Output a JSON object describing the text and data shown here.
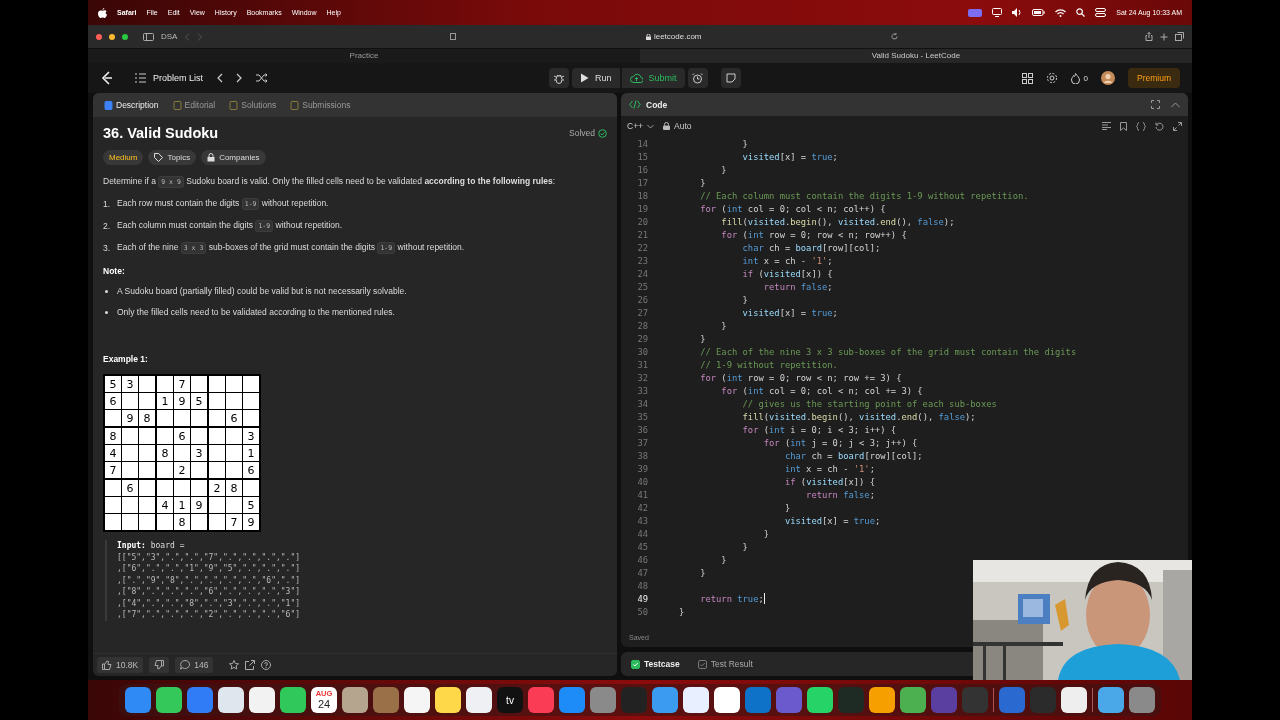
{
  "menubar": {
    "app": "Safari",
    "items": [
      "File",
      "Edit",
      "View",
      "History",
      "Bookmarks",
      "Window",
      "Help"
    ],
    "clock": "Sat 24 Aug 10:33 AM"
  },
  "browser": {
    "profile": "DSA",
    "url": "leetcode.com",
    "tabs": [
      {
        "title": "Practice",
        "selected": false
      },
      {
        "title": "Valid Sudoku - LeetCode",
        "selected": true
      }
    ]
  },
  "nav": {
    "problem_list": "Problem List",
    "run": "Run",
    "submit": "Submit",
    "streak": "0",
    "premium": "Premium"
  },
  "description": {
    "tabs": [
      {
        "label": "Description",
        "selected": true
      },
      {
        "label": "Editorial",
        "selected": false
      },
      {
        "label": "Solutions",
        "selected": false
      },
      {
        "label": "Submissions",
        "selected": false
      }
    ],
    "title": "36. Valid Sudoku",
    "status": "Solved",
    "difficulty": "Medium",
    "tags": [
      "Topics",
      "Companies"
    ],
    "intro": [
      {
        "text": "Determine if a "
      },
      {
        "code": "9 x 9"
      },
      {
        "text": " Sudoku board is valid. Only the filled cells need to be validated **according to the following rules**:"
      }
    ],
    "rules": [
      {
        "num": "1.",
        "parts": [
          {
            "text": "Each row must contain the digits "
          },
          {
            "code": "1-9"
          },
          {
            "text": " without repetition."
          }
        ]
      },
      {
        "num": "2.",
        "parts": [
          {
            "text": "Each column must contain the digits "
          },
          {
            "code": "1-9"
          },
          {
            "text": " without repetition."
          }
        ]
      },
      {
        "num": "3.",
        "parts": [
          {
            "text": "Each of the nine "
          },
          {
            "code": "3 x 3"
          },
          {
            "text": " sub-boxes of the grid must contain the digits "
          },
          {
            "code": "1-9"
          },
          {
            "text": " without repetition."
          }
        ]
      }
    ],
    "note_heading": "Note:",
    "notes": [
      "A Sudoku board (partially filled) could be valid but is not necessarily solvable.",
      "Only the filled cells need to be validated according to the mentioned rules."
    ],
    "example_heading": "Example 1:",
    "board": [
      [
        {
          "kind": "digit",
          "digit": "5"
        },
        {
          "kind": "digit",
          "digit": "3"
        },
        {
          "kind": "empty"
        },
        {
          "kind": "empty"
        },
        {
          "kind": "digit",
          "digit": "7"
        },
        {
          "kind": "empty"
        },
        {
          "kind": "empty"
        },
        {
          "kind": "empty"
        },
        {
          "kind": "empty"
        }
      ],
      [
        {
          "kind": "digit",
          "digit": "6"
        },
        {
          "kind": "empty"
        },
        {
          "kind": "empty"
        },
        {
          "kind": "digit",
          "digit": "1"
        },
        {
          "kind": "digit",
          "digit": "9"
        },
        {
          "kind": "digit",
          "digit": "5"
        },
        {
          "kind": "empty"
        },
        {
          "kind": "empty"
        },
        {
          "kind": "empty"
        }
      ],
      [
        {
          "kind": "empty"
        },
        {
          "kind": "digit",
          "digit": "9"
        },
        {
          "kind": "digit",
          "digit": "8"
        },
        {
          "kind": "empty"
        },
        {
          "kind": "empty"
        },
        {
          "kind": "empty"
        },
        {
          "kind": "empty"
        },
        {
          "kind": "digit",
          "digit": "6"
        },
        {
          "kind": "empty"
        }
      ],
      [
        {
          "kind": "digit",
          "digit": "8"
        },
        {
          "kind": "empty"
        },
        {
          "kind": "empty"
        },
        {
          "kind": "empty"
        },
        {
          "kind": "digit",
          "digit": "6"
        },
        {
          "kind": "empty"
        },
        {
          "kind": "empty"
        },
        {
          "kind": "empty"
        },
        {
          "kind": "digit",
          "digit": "3"
        }
      ],
      [
        {
          "kind": "digit",
          "digit": "4"
        },
        {
          "kind": "empty"
        },
        {
          "kind": "empty"
        },
        {
          "kind": "digit",
          "digit": "8"
        },
        {
          "kind": "empty"
        },
        {
          "kind": "digit",
          "digit": "3"
        },
        {
          "kind": "empty"
        },
        {
          "kind": "empty"
        },
        {
          "kind": "digit",
          "digit": "1"
        }
      ],
      [
        {
          "kind": "digit",
          "digit": "7"
        },
        {
          "kind": "empty"
        },
        {
          "kind": "empty"
        },
        {
          "kind": "empty"
        },
        {
          "kind": "digit",
          "digit": "2"
        },
        {
          "kind": "empty"
        },
        {
          "kind": "empty"
        },
        {
          "kind": "empty"
        },
        {
          "kind": "digit",
          "digit": "6"
        }
      ],
      [
        {
          "kind": "empty"
        },
        {
          "kind": "digit",
          "digit": "6"
        },
        {
          "kind": "empty"
        },
        {
          "kind": "empty"
        },
        {
          "kind": "empty"
        },
        {
          "kind": "empty"
        },
        {
          "kind": "digit",
          "digit": "2"
        },
        {
          "kind": "digit",
          "digit": "8"
        },
        {
          "kind": "empty"
        }
      ],
      [
        {
          "kind": "empty"
        },
        {
          "kind": "empty"
        },
        {
          "kind": "empty"
        },
        {
          "kind": "digit",
          "digit": "4"
        },
        {
          "kind": "digit",
          "digit": "1"
        },
        {
          "kind": "digit",
          "digit": "9"
        },
        {
          "kind": "empty"
        },
        {
          "kind": "empty"
        },
        {
          "kind": "digit",
          "digit": "5"
        }
      ],
      [
        {
          "kind": "empty"
        },
        {
          "kind": "empty"
        },
        {
          "kind": "empty"
        },
        {
          "kind": "empty"
        },
        {
          "kind": "digit",
          "digit": "8"
        },
        {
          "kind": "empty"
        },
        {
          "kind": "empty"
        },
        {
          "kind": "digit",
          "digit": "7"
        },
        {
          "kind": "digit",
          "digit": "9"
        }
      ]
    ],
    "input_label": "Input:",
    "input_intro": "board =",
    "input_lines": [
      "[[\"5\",\"3\",\".\",\".\",\"7\",\".\",\".\",\".\",\".\"]",
      ",[\"6\",\".\",\".\",\"1\",\"9\",\"5\",\".\",\".\",\".\"]",
      ",[\".\",\"9\",\"8\",\".\",\".\",\".\",\".\",\"6\",\".\"]",
      ",[\"8\",\".\",\".\",\".\",\"6\",\".\",\".\",\".\",\"3\"]",
      ",[\"4\",\".\",\".\",\"8\",\".\",\"3\",\".\",\".\",\"1\"]",
      ",[\"7\",\".\",\".\",\".\",\"2\",\".\",\".\",\".\",\"6\"]"
    ],
    "likes": "10.8K",
    "comments": "146"
  },
  "code": {
    "title": "Code",
    "language": "C++",
    "mode": "Auto",
    "status": "Saved",
    "lines": [
      {
        "n": "14",
        "current": false,
        "s": [
          {
            "kind": "plain",
            "text": "            }"
          }
        ]
      },
      {
        "n": "15",
        "current": false,
        "s": [
          {
            "kind": "variable",
            "text": "            visited"
          },
          {
            "kind": "plain",
            "text": "[x] = "
          },
          {
            "kind": "type",
            "text": "true"
          },
          {
            "kind": "plain",
            "text": ";"
          }
        ]
      },
      {
        "n": "16",
        "current": false,
        "s": [
          {
            "kind": "plain",
            "text": "        }"
          }
        ]
      },
      {
        "n": "17",
        "current": false,
        "s": [
          {
            "kind": "plain",
            "text": "    }"
          }
        ]
      },
      {
        "n": "18",
        "current": false,
        "s": [
          {
            "kind": "comment",
            "text": "    // Each column must contain the digits 1-9 without repetition."
          }
        ]
      },
      {
        "n": "19",
        "current": false,
        "s": [
          {
            "kind": "keyword",
            "text": "    for"
          },
          {
            "kind": "plain",
            "text": " ("
          },
          {
            "kind": "type",
            "text": "int"
          },
          {
            "kind": "plain",
            "text": " col = 0; col < n; col++) {"
          }
        ]
      },
      {
        "n": "20",
        "current": false,
        "s": [
          {
            "kind": "function",
            "text": "        fill"
          },
          {
            "kind": "plain",
            "text": "("
          },
          {
            "kind": "variable",
            "text": "visited"
          },
          {
            "kind": "plain",
            "text": "."
          },
          {
            "kind": "function",
            "text": "begin"
          },
          {
            "kind": "plain",
            "text": "(), "
          },
          {
            "kind": "variable",
            "text": "visited"
          },
          {
            "kind": "plain",
            "text": "."
          },
          {
            "kind": "function",
            "text": "end"
          },
          {
            "kind": "plain",
            "text": "(), "
          },
          {
            "kind": "type",
            "text": "false"
          },
          {
            "kind": "plain",
            "text": ");"
          }
        ]
      },
      {
        "n": "21",
        "current": false,
        "s": [
          {
            "kind": "keyword",
            "text": "        for"
          },
          {
            "kind": "plain",
            "text": " ("
          },
          {
            "kind": "type",
            "text": "int"
          },
          {
            "kind": "plain",
            "text": " row = 0; row < n; row++) {"
          }
        ]
      },
      {
        "n": "22",
        "current": false,
        "s": [
          {
            "kind": "type",
            "text": "            char"
          },
          {
            "kind": "plain",
            "text": " ch = "
          },
          {
            "kind": "variable",
            "text": "board"
          },
          {
            "kind": "plain",
            "text": "[row][col];"
          }
        ]
      },
      {
        "n": "23",
        "current": false,
        "s": [
          {
            "kind": "type",
            "text": "            int"
          },
          {
            "kind": "plain",
            "text": " x = ch - "
          },
          {
            "kind": "string",
            "text": "'1'"
          },
          {
            "kind": "plain",
            "text": ";"
          }
        ]
      },
      {
        "n": "24",
        "current": false,
        "s": [
          {
            "kind": "keyword",
            "text": "            if"
          },
          {
            "kind": "plain",
            "text": " ("
          },
          {
            "kind": "variable",
            "text": "visited"
          },
          {
            "kind": "plain",
            "text": "[x]) {"
          }
        ]
      },
      {
        "n": "25",
        "current": false,
        "s": [
          {
            "kind": "keyword",
            "text": "                return "
          },
          {
            "kind": "type",
            "text": "false"
          },
          {
            "kind": "plain",
            "text": ";"
          }
        ]
      },
      {
        "n": "26",
        "current": false,
        "s": [
          {
            "kind": "plain",
            "text": "            }"
          }
        ]
      },
      {
        "n": "27",
        "current": false,
        "s": [
          {
            "kind": "variable",
            "text": "            visited"
          },
          {
            "kind": "plain",
            "text": "[x] = "
          },
          {
            "kind": "type",
            "text": "true"
          },
          {
            "kind": "plain",
            "text": ";"
          }
        ]
      },
      {
        "n": "28",
        "current": false,
        "s": [
          {
            "kind": "plain",
            "text": "        }"
          }
        ]
      },
      {
        "n": "29",
        "current": false,
        "s": [
          {
            "kind": "plain",
            "text": "    }"
          }
        ]
      },
      {
        "n": "30",
        "current": false,
        "s": [
          {
            "kind": "comment",
            "text": "    // Each of the nine 3 x 3 sub-boxes of the grid must contain the digits"
          }
        ]
      },
      {
        "n": "31",
        "current": false,
        "s": [
          {
            "kind": "comment",
            "text": "    // 1-9 without repetition."
          }
        ]
      },
      {
        "n": "32",
        "current": false,
        "s": [
          {
            "kind": "keyword",
            "text": "    for"
          },
          {
            "kind": "plain",
            "text": " ("
          },
          {
            "kind": "type",
            "text": "int"
          },
          {
            "kind": "plain",
            "text": " row = 0; row < n; row += 3) {"
          }
        ]
      },
      {
        "n": "33",
        "current": false,
        "s": [
          {
            "kind": "keyword",
            "text": "        for"
          },
          {
            "kind": "plain",
            "text": " ("
          },
          {
            "kind": "type",
            "text": "int"
          },
          {
            "kind": "plain",
            "text": " col = 0; col < n; col += 3) {"
          }
        ]
      },
      {
        "n": "34",
        "current": false,
        "s": [
          {
            "kind": "comment",
            "text": "            // gives us the starting point of each sub-boxes"
          }
        ]
      },
      {
        "n": "35",
        "current": false,
        "s": [
          {
            "kind": "function",
            "text": "            fill"
          },
          {
            "kind": "plain",
            "text": "("
          },
          {
            "kind": "variable",
            "text": "visited"
          },
          {
            "kind": "plain",
            "text": "."
          },
          {
            "kind": "function",
            "text": "begin"
          },
          {
            "kind": "plain",
            "text": "(), "
          },
          {
            "kind": "variable",
            "text": "visited"
          },
          {
            "kind": "plain",
            "text": "."
          },
          {
            "kind": "function",
            "text": "end"
          },
          {
            "kind": "plain",
            "text": "(), "
          },
          {
            "kind": "type",
            "text": "false"
          },
          {
            "kind": "plain",
            "text": ");"
          }
        ]
      },
      {
        "n": "36",
        "current": false,
        "s": [
          {
            "kind": "keyword",
            "text": "            for"
          },
          {
            "kind": "plain",
            "text": " ("
          },
          {
            "kind": "type",
            "text": "int"
          },
          {
            "kind": "plain",
            "text": " i = 0; i < 3; i++) {"
          }
        ]
      },
      {
        "n": "37",
        "current": false,
        "s": [
          {
            "kind": "keyword",
            "text": "                for"
          },
          {
            "kind": "plain",
            "text": " ("
          },
          {
            "kind": "type",
            "text": "int"
          },
          {
            "kind": "plain",
            "text": " j = 0; j < 3; j++) {"
          }
        ]
      },
      {
        "n": "38",
        "current": false,
        "s": [
          {
            "kind": "type",
            "text": "                    char"
          },
          {
            "kind": "plain",
            "text": " ch = "
          },
          {
            "kind": "variable",
            "text": "board"
          },
          {
            "kind": "plain",
            "text": "[row][col];"
          }
        ]
      },
      {
        "n": "39",
        "current": false,
        "s": [
          {
            "kind": "type",
            "text": "                    int"
          },
          {
            "kind": "plain",
            "text": " x = ch - "
          },
          {
            "kind": "string",
            "text": "'1'"
          },
          {
            "kind": "plain",
            "text": ";"
          }
        ]
      },
      {
        "n": "40",
        "current": false,
        "s": [
          {
            "kind": "keyword",
            "text": "                    if"
          },
          {
            "kind": "plain",
            "text": " ("
          },
          {
            "kind": "variable",
            "text": "visited"
          },
          {
            "kind": "plain",
            "text": "[x]) {"
          }
        ]
      },
      {
        "n": "41",
        "current": false,
        "s": [
          {
            "kind": "keyword",
            "text": "                        return "
          },
          {
            "kind": "type",
            "text": "false"
          },
          {
            "kind": "plain",
            "text": ";"
          }
        ]
      },
      {
        "n": "42",
        "current": false,
        "s": [
          {
            "kind": "plain",
            "text": "                    }"
          }
        ]
      },
      {
        "n": "43",
        "current": false,
        "s": [
          {
            "kind": "variable",
            "text": "                    visited"
          },
          {
            "kind": "plain",
            "text": "[x] = "
          },
          {
            "kind": "type",
            "text": "true"
          },
          {
            "kind": "plain",
            "text": ";"
          }
        ]
      },
      {
        "n": "44",
        "current": false,
        "s": [
          {
            "kind": "plain",
            "text": "                }"
          }
        ]
      },
      {
        "n": "45",
        "current": false,
        "s": [
          {
            "kind": "plain",
            "text": "            }"
          }
        ]
      },
      {
        "n": "46",
        "current": false,
        "s": [
          {
            "kind": "plain",
            "text": "        }"
          }
        ]
      },
      {
        "n": "47",
        "current": false,
        "s": [
          {
            "kind": "plain",
            "text": "    }"
          }
        ]
      },
      {
        "n": "48",
        "current": false
      },
      {
        "n": "49",
        "current": true,
        "s": [
          {
            "kind": "keyword",
            "text": "    return "
          },
          {
            "kind": "type",
            "text": "true"
          },
          {
            "kind": "plain",
            "text": ";"
          }
        ]
      },
      {
        "n": "50",
        "current": false,
        "s": [
          {
            "kind": "plain",
            "text": "}"
          }
        ]
      }
    ]
  },
  "bottom_tabs": [
    {
      "label": "Testcase",
      "selected": true
    },
    {
      "label": "Test Result",
      "selected": false
    }
  ],
  "dock": {
    "calendar_month": "AUG",
    "calendar_day": "24",
    "tv_label": "tv"
  }
}
